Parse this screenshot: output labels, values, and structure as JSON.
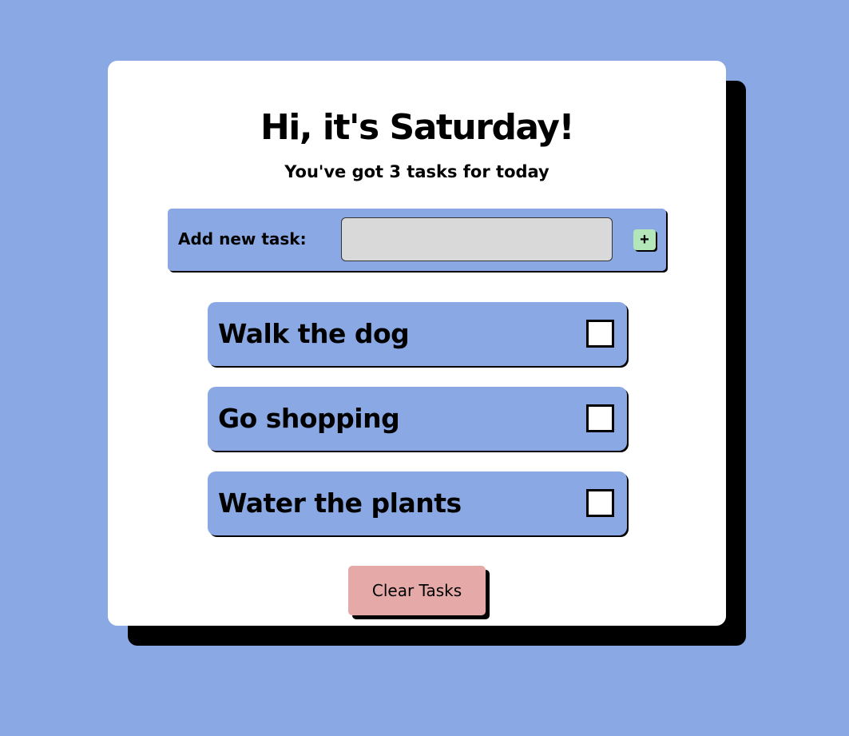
{
  "header": {
    "greeting": "Hi, it's Saturday!",
    "subtitle": "You've got 3 tasks for today"
  },
  "add_task": {
    "label": "Add new task:",
    "input_value": "",
    "button_label": "+"
  },
  "tasks": [
    {
      "text": "Walk the dog",
      "checked": false
    },
    {
      "text": "Go shopping",
      "checked": false
    },
    {
      "text": "Water the plants",
      "checked": false
    }
  ],
  "actions": {
    "clear_label": "Clear Tasks"
  },
  "colors": {
    "background": "#8aa8e4",
    "card": "#ffffff",
    "input_bg": "#d9d9d9",
    "add_button": "#b3e6b8",
    "clear_button": "#e5aaa8",
    "shadow": "#000000"
  }
}
